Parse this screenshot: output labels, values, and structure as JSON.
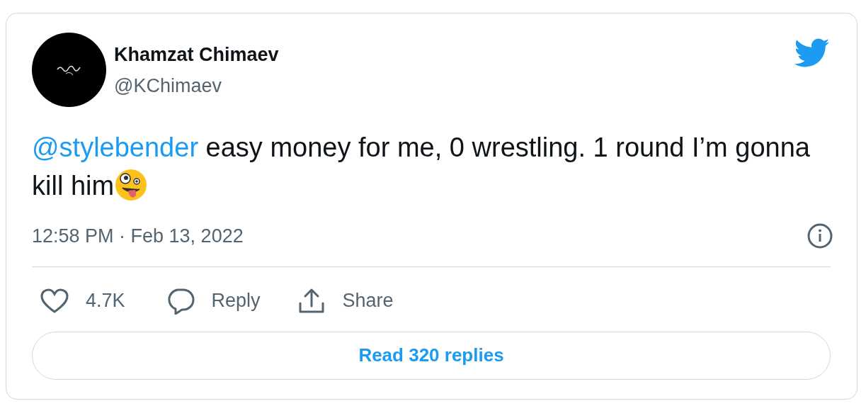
{
  "author": {
    "name": "Khamzat Chimaev",
    "handle": "@KChimaev"
  },
  "tweet": {
    "mention": "@stylebender",
    "text": " easy money for me, 0 wrestling. 1 round I’m gonna kill him"
  },
  "timestamp": "12:58 PM · Feb 13, 2022",
  "actions": [
    {
      "kind": "like",
      "label": "4.7K"
    },
    {
      "kind": "reply",
      "label": "Reply"
    },
    {
      "kind": "share",
      "label": "Share"
    }
  ],
  "read_replies_button": "Read 320 replies"
}
